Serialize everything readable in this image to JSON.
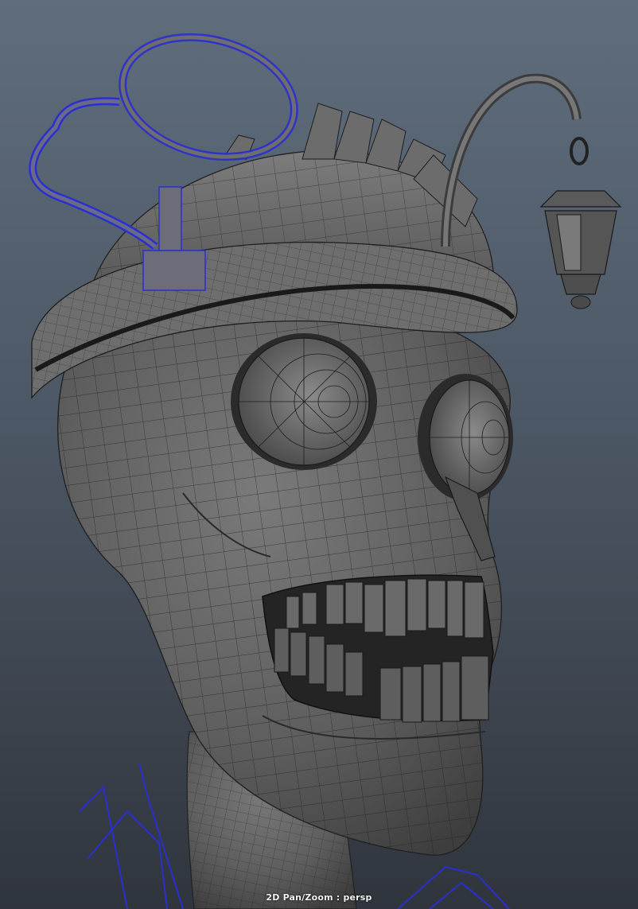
{
  "viewport": {
    "camera_label": "2D Pan/Zoom : persp",
    "accent_selected_wire": "#2a2fd0",
    "mesh_fill": "#646464",
    "mesh_wire": "#1c1c1c",
    "background_top": "#5f6d7c",
    "background_bottom": "#30353d"
  },
  "scene": {
    "objects": [
      "skull-head-mesh",
      "bowler-hat-mesh",
      "lantern-mesh",
      "ring-wire-selected",
      "body-wire-selected"
    ]
  }
}
